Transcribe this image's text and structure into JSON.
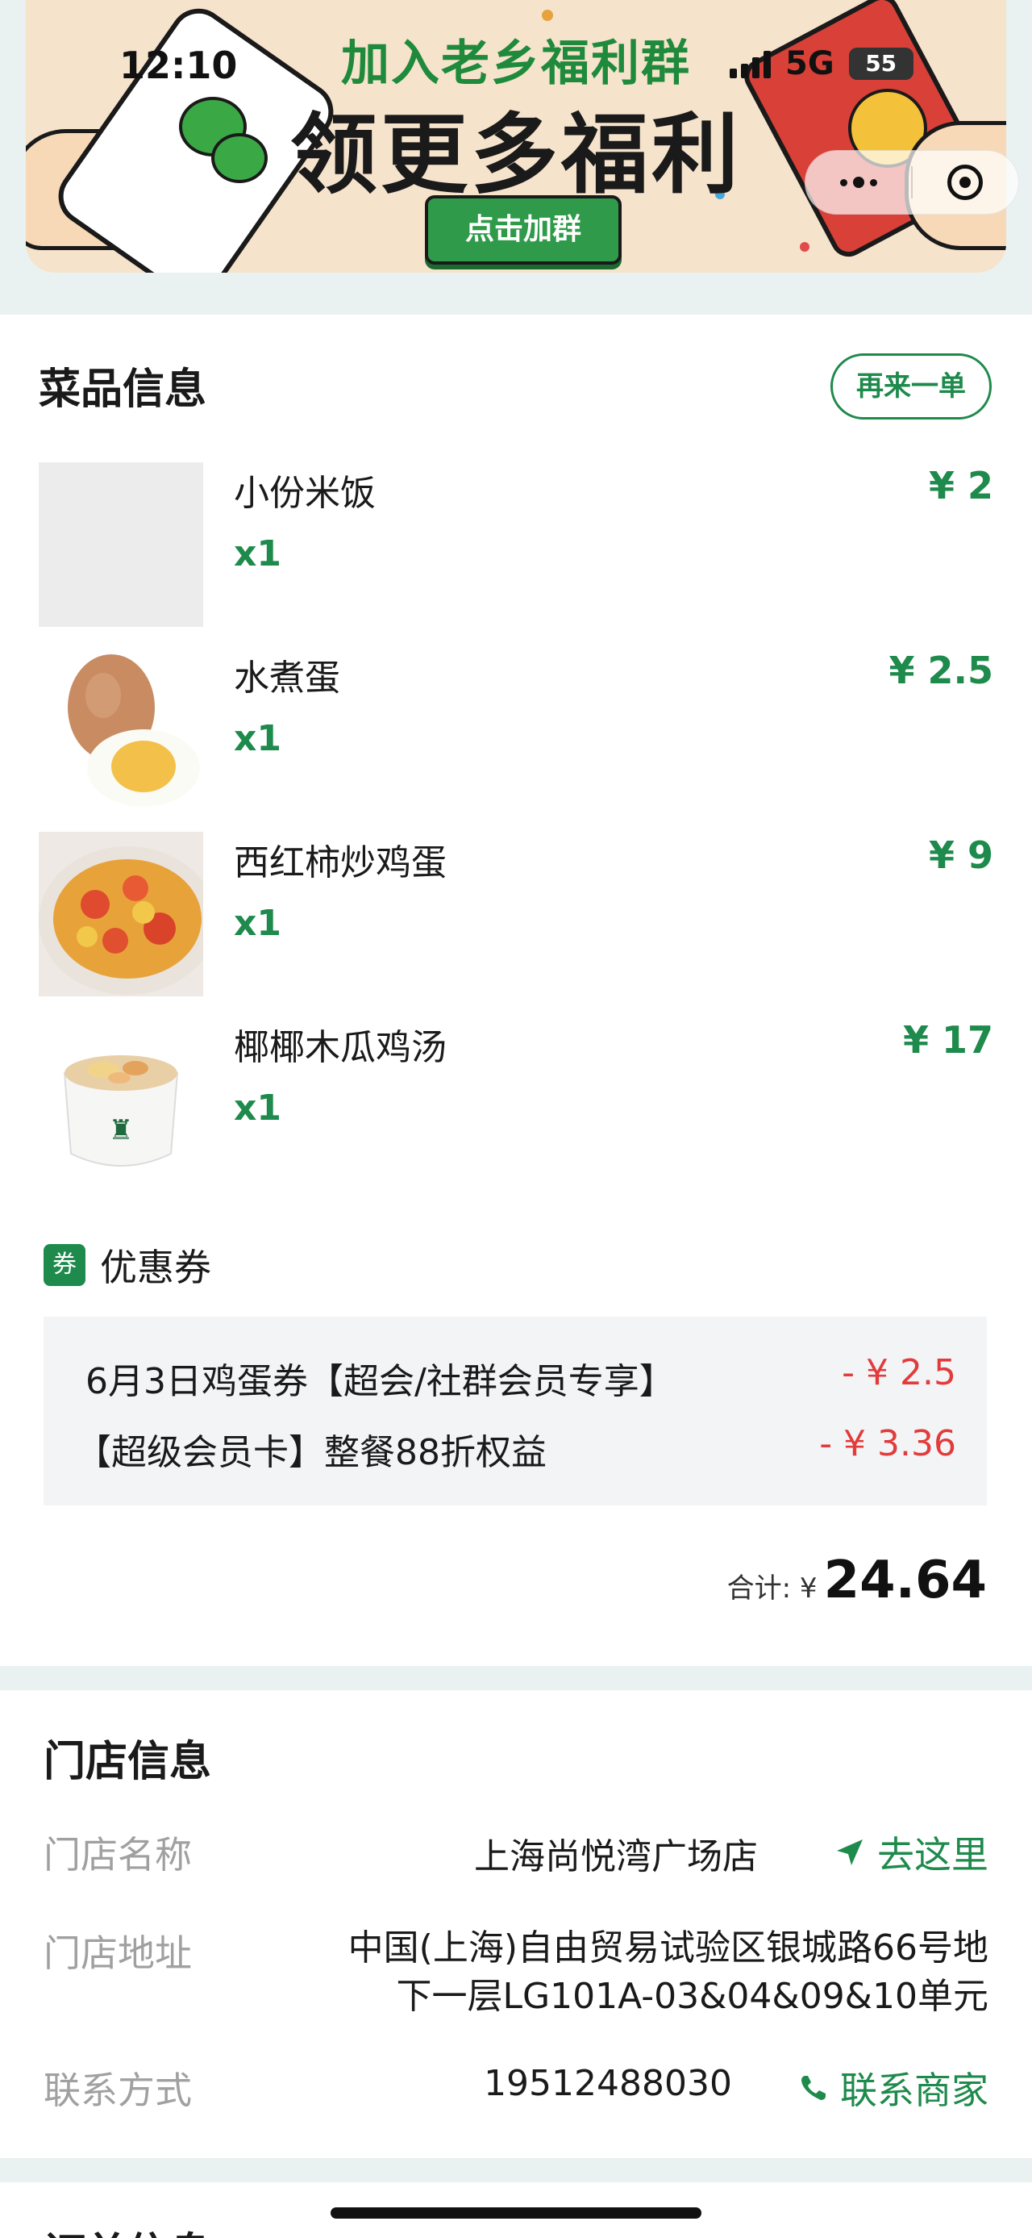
{
  "status_bar": {
    "time": "12:10",
    "network": "5G",
    "battery": "55"
  },
  "banner": {
    "line1": "加入老乡福利群",
    "line2": "领更多福利",
    "button": "点击加群"
  },
  "capsule": {
    "more_icon": "more-dots-icon",
    "close_icon": "target-circle-icon"
  },
  "dishes_section": {
    "title": "菜品信息",
    "reorder_button": "再来一单",
    "items": [
      {
        "name": "小份米饭",
        "qty": "x1",
        "price": "¥ 2"
      },
      {
        "name": "水煮蛋",
        "qty": "x1",
        "price": "¥ 2.5"
      },
      {
        "name": "西红柿炒鸡蛋",
        "qty": "x1",
        "price": "¥ 9"
      },
      {
        "name": "椰椰木瓜鸡汤",
        "qty": "x1",
        "price": "¥ 17"
      }
    ],
    "coupon": {
      "badge": "券",
      "label": "优惠券",
      "rows": [
        {
          "text": "6月3日鸡蛋券【超会/社群会员专享】",
          "amount": "- ¥ 2.5"
        },
        {
          "text": "【超级会员卡】整餐88折权益",
          "amount": "- ¥ 3.36"
        }
      ]
    },
    "total_label": "合计: ¥",
    "total_value": "24.64"
  },
  "store_section": {
    "title": "门店信息",
    "name_label": "门店名称",
    "name_value": "上海尚悦湾广场店",
    "navigate": "去这里",
    "address_label": "门店地址",
    "address_line1": "中国(上海)自由贸易试验区银城路66号地",
    "address_line2": "下一层LG101A-03&04&09&10单元",
    "contact_label": "联系方式",
    "contact_value": "19512488030",
    "contact_action": "联系商家"
  },
  "next_section": {
    "title": "订单信息"
  },
  "colors": {
    "accent_green": "#1e8a4c",
    "discount_red": "#e23b3b",
    "page_bg": "#eaf1f1"
  }
}
